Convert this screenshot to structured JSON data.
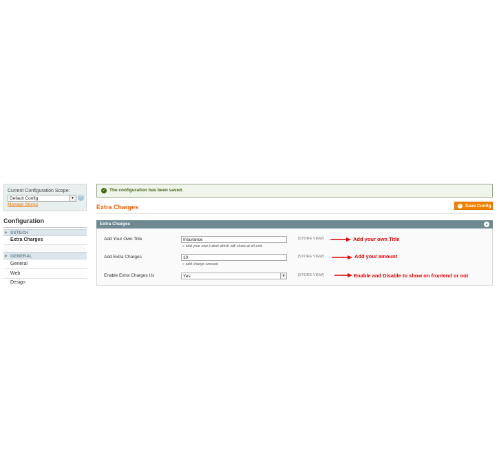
{
  "sidebar": {
    "scope_label": "Current Configuration Scope:",
    "scope_value": "Default Config",
    "manage_link": "Manage Stores",
    "config_title": "Configuration",
    "groups": [
      {
        "label": "SSTECH",
        "items": [
          "Extra Charges"
        ]
      },
      {
        "label": "GENERAL",
        "items": [
          "General",
          "Web",
          "Design"
        ]
      }
    ]
  },
  "main": {
    "success_message": "The configuration has been saved.",
    "page_title": "Extra Charges",
    "save_button": "Save Config",
    "section_title": "Extra Charges",
    "fields": [
      {
        "label": "Add Your Own Title",
        "value": "Insurance",
        "note": "add your own Label which will show at all end",
        "scope": "[STORE VIEW]",
        "annotation": "Add your own Title"
      },
      {
        "label": "Add Extra Charges",
        "value": "10",
        "note": "add charge amount",
        "scope": "[STORE VIEW]",
        "annotation": "Add your amount"
      },
      {
        "label": "Enable Extra Charges Us",
        "value": "Yes",
        "note": "",
        "scope": "[STORE VIEW]",
        "annotation": "Enable and Disable to show on frontend or not"
      }
    ]
  },
  "colors": {
    "accent_orange": "#eb5e00",
    "section_header": "#6f8992",
    "success_green": "#3d6611",
    "annotation_red": "#e00000"
  }
}
